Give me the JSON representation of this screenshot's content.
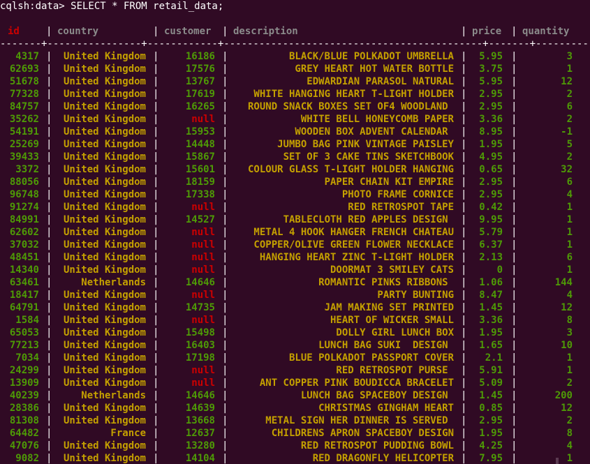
{
  "prompt": "cqlsh:data> SELECT * FROM retail_data;",
  "headers": {
    "id": "id",
    "country": "country",
    "customer": "customer",
    "description": "description",
    "price": "price",
    "quantity": "quantity"
  },
  "separator": "-------+----------------+------------+--------------------------------------------+-------+-----------",
  "rows": [
    {
      "id": "4317",
      "country": "United Kingdom",
      "customer": "16186",
      "description": "BLACK/BLUE POLKADOT UMBRELLA",
      "price": "5.95",
      "quantity": "3"
    },
    {
      "id": "62693",
      "country": "United Kingdom",
      "customer": "17576",
      "description": "GREY HEART HOT WATER BOTTLE",
      "price": "3.75",
      "quantity": "1"
    },
    {
      "id": "51678",
      "country": "United Kingdom",
      "customer": "13767",
      "description": "EDWARDIAN PARASOL NATURAL",
      "price": "5.95",
      "quantity": "12"
    },
    {
      "id": "77328",
      "country": "United Kingdom",
      "customer": "17619",
      "description": "WHITE HANGING HEART T-LIGHT HOLDER",
      "price": "2.95",
      "quantity": "2"
    },
    {
      "id": "84757",
      "country": "United Kingdom",
      "customer": "16265",
      "description": "ROUND SNACK BOXES SET OF4 WOODLAND ",
      "price": "2.95",
      "quantity": "6"
    },
    {
      "id": "35262",
      "country": "United Kingdom",
      "customer": "null",
      "description": "WHITE BELL HONEYCOMB PAPER",
      "price": "3.36",
      "quantity": "2"
    },
    {
      "id": "54191",
      "country": "United Kingdom",
      "customer": "15953",
      "description": "WOODEN BOX ADVENT CALENDAR ",
      "price": "8.95",
      "quantity": "-1"
    },
    {
      "id": "25269",
      "country": "United Kingdom",
      "customer": "14448",
      "description": "JUMBO BAG PINK VINTAGE PAISLEY",
      "price": "1.95",
      "quantity": "5"
    },
    {
      "id": "39433",
      "country": "United Kingdom",
      "customer": "15867",
      "description": "SET OF 3 CAKE TINS SKETCHBOOK",
      "price": "4.95",
      "quantity": "2"
    },
    {
      "id": "3372",
      "country": "United Kingdom",
      "customer": "15601",
      "description": "COLOUR GLASS T-LIGHT HOLDER HANGING",
      "price": "0.65",
      "quantity": "32"
    },
    {
      "id": "88056",
      "country": "United Kingdom",
      "customer": "18159",
      "description": "PAPER CHAIN KIT EMPIRE",
      "price": "2.95",
      "quantity": "6"
    },
    {
      "id": "96748",
      "country": "United Kingdom",
      "customer": "17338",
      "description": "PHOTO FRAME CORNICE",
      "price": "2.95",
      "quantity": "4"
    },
    {
      "id": "91274",
      "country": "United Kingdom",
      "customer": "null",
      "description": "RED RETROSPOT TAPE",
      "price": "0.42",
      "quantity": "1"
    },
    {
      "id": "84991",
      "country": "United Kingdom",
      "customer": "14527",
      "description": "TABLECLOTH RED APPLES DESIGN ",
      "price": "9.95",
      "quantity": "1"
    },
    {
      "id": "62602",
      "country": "United Kingdom",
      "customer": "null",
      "description": "METAL 4 HOOK HANGER FRENCH CHATEAU",
      "price": "5.79",
      "quantity": "1"
    },
    {
      "id": "37032",
      "country": "United Kingdom",
      "customer": "null",
      "description": "COPPER/OLIVE GREEN FLOWER NECKLACE",
      "price": "6.37",
      "quantity": "1"
    },
    {
      "id": "48451",
      "country": "United Kingdom",
      "customer": "null",
      "description": "HANGING HEART ZINC T-LIGHT HOLDER",
      "price": "2.13",
      "quantity": "6"
    },
    {
      "id": "14340",
      "country": "United Kingdom",
      "customer": "null",
      "description": "DOORMAT 3 SMILEY CATS",
      "price": "0",
      "quantity": "1"
    },
    {
      "id": "63461",
      "country": "Netherlands",
      "customer": "14646",
      "description": "ROMANTIC PINKS RIBBONS ",
      "price": "1.06",
      "quantity": "144"
    },
    {
      "id": "18417",
      "country": "United Kingdom",
      "customer": "null",
      "description": "PARTY BUNTING",
      "price": "8.47",
      "quantity": "4"
    },
    {
      "id": "64791",
      "country": "United Kingdom",
      "customer": "14735",
      "description": "JAM MAKING SET PRINTED",
      "price": "1.45",
      "quantity": "12"
    },
    {
      "id": "1584",
      "country": "United Kingdom",
      "customer": "null",
      "description": "HEART OF WICKER SMALL",
      "price": "3.36",
      "quantity": "8"
    },
    {
      "id": "65053",
      "country": "United Kingdom",
      "customer": "15498",
      "description": "DOLLY GIRL LUNCH BOX",
      "price": "1.95",
      "quantity": "3"
    },
    {
      "id": "77213",
      "country": "United Kingdom",
      "customer": "16403",
      "description": "LUNCH BAG SUKI  DESIGN ",
      "price": "1.65",
      "quantity": "10"
    },
    {
      "id": "7034",
      "country": "United Kingdom",
      "customer": "17198",
      "description": "BLUE POLKADOT PASSPORT COVER",
      "price": "2.1",
      "quantity": "1"
    },
    {
      "id": "24299",
      "country": "United Kingdom",
      "customer": "null",
      "description": "RED RETROSPOT PURSE ",
      "price": "5.91",
      "quantity": "1"
    },
    {
      "id": "13909",
      "country": "United Kingdom",
      "customer": "null",
      "description": "ANT COPPER PINK BOUDICCA BRACELET",
      "price": "5.09",
      "quantity": "2"
    },
    {
      "id": "40239",
      "country": "Netherlands",
      "customer": "14646",
      "description": "LUNCH BAG SPACEBOY DESIGN ",
      "price": "1.45",
      "quantity": "200"
    },
    {
      "id": "28386",
      "country": "United Kingdom",
      "customer": "14639",
      "description": "CHRISTMAS GINGHAM HEART",
      "price": "0.85",
      "quantity": "12"
    },
    {
      "id": "81308",
      "country": "United Kingdom",
      "customer": "13668",
      "description": "METAL SIGN HER DINNER IS SERVED ",
      "price": "2.95",
      "quantity": "2"
    },
    {
      "id": "64482",
      "country": "France",
      "customer": "12637",
      "description": "CHILDRENS APRON SPACEBOY DESIGN",
      "price": "1.95",
      "quantity": "8"
    },
    {
      "id": "47076",
      "country": "United Kingdom",
      "customer": "13280",
      "description": "RED RETROSPOT PUDDING BOWL",
      "price": "4.25",
      "quantity": "4"
    },
    {
      "id": "9082",
      "country": "United Kingdom",
      "customer": "14104",
      "description": "RED DRAGONFLY HELICOPTER",
      "price": "7.95",
      "quantity": "1"
    }
  ],
  "colors": {
    "background": "#300a24",
    "id": "#4e9a06",
    "text_values": "#c4a000",
    "numbers": "#4e9a06",
    "null": "#cc0000",
    "header_id": "#cc0000",
    "header": "#8b8b8b"
  }
}
